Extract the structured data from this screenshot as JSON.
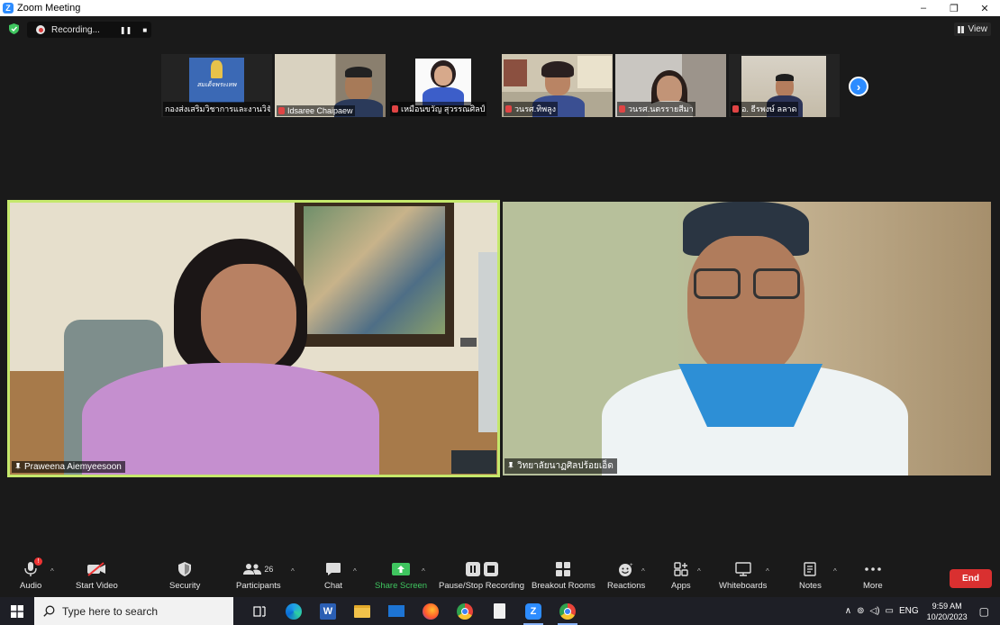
{
  "window": {
    "title": "Zoom Meeting",
    "controls": {
      "minimize": "–",
      "restore": "❐",
      "close": "✕"
    }
  },
  "recording": {
    "label": "Recording...",
    "pause": "❚❚",
    "stop": "■"
  },
  "view_button": {
    "label": "View"
  },
  "thumbnails": [
    {
      "name": "กองส่งเสริมวิชาการและงานวิจัย",
      "muted": false,
      "logo_text": "สมเด็จพระเทพ"
    },
    {
      "name": "Idsaree Chaipaew",
      "muted": true
    },
    {
      "name": "เหมือนขวัญ สุวรรณศิลป์",
      "muted": true
    },
    {
      "name": "รศ.ทิพลูง",
      "muted": true,
      "prefix": "วน"
    },
    {
      "name": "รศ.นตรรายสีมา",
      "muted": true,
      "prefix": "วน"
    },
    {
      "name": "อ. ธีรพงษ์ ลลาด",
      "muted": true
    }
  ],
  "thumbnail_next": "›",
  "main_tiles": {
    "left": {
      "name": "Praweena Aiemyeesoon"
    },
    "right": {
      "name": "วิทยาลัยนาฏศิลปร้อยเอ็ด"
    }
  },
  "toolbar": {
    "audio": "Audio",
    "start_video": "Start Video",
    "security": "Security",
    "participants": "Participants",
    "participants_count": "26",
    "chat": "Chat",
    "share_screen": "Share Screen",
    "pause_stop_recording": "Pause/Stop Recording",
    "breakout_rooms": "Breakout Rooms",
    "reactions": "Reactions",
    "apps": "Apps",
    "whiteboards": "Whiteboards",
    "notes": "Notes",
    "more": "More",
    "end": "End"
  },
  "taskbar": {
    "search_placeholder": "Type here to search",
    "tray_lang": "ENG",
    "time": "9:59 AM",
    "date": "10/20/2023"
  },
  "colors": {
    "accent": "#2d8cff",
    "share_green": "#3fc55f",
    "end_red": "#d93030",
    "active_speaker": "#c5e86c"
  }
}
